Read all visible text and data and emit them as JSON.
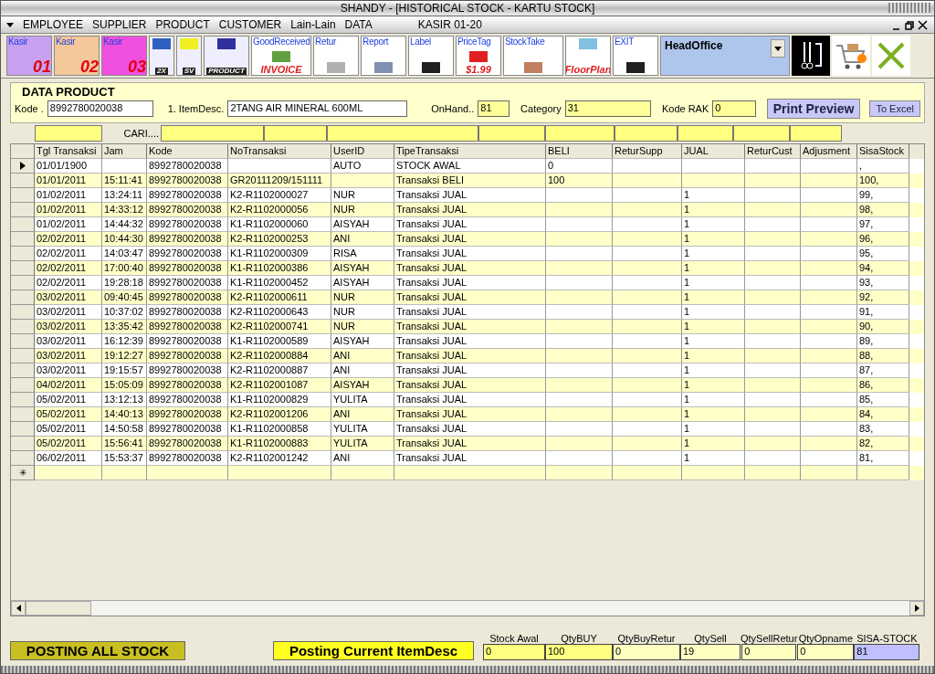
{
  "window": {
    "title": "SHANDY - [HISTORICAL STOCK - KARTU STOCK]"
  },
  "menu": [
    "EMPLOYEE",
    "SUPPLIER",
    "PRODUCT",
    "CUSTOMER",
    "Lain-Lain",
    "DATA"
  ],
  "menu_right": "KASIR 01-20",
  "toolbar": [
    {
      "kind": "kasir",
      "label": "Kasir",
      "sub": "01",
      "color": "#c8a0f0"
    },
    {
      "kind": "kasir",
      "label": "Kasir",
      "sub": "02",
      "color": "#f4c89a"
    },
    {
      "kind": "kasir",
      "label": "Kasir",
      "sub": "03",
      "color": "#f050e0"
    },
    {
      "kind": "art",
      "sub": "2X",
      "color": "#3060c0"
    },
    {
      "kind": "art",
      "sub": "SV",
      "color": "#f0f020"
    },
    {
      "kind": "art",
      "sub": "PRODUCT",
      "color": "#3030a0"
    },
    {
      "kind": "labeled",
      "label": "GoodReceived",
      "sub": "INVOICE",
      "color": "#60a040"
    },
    {
      "kind": "labeled",
      "label": "Retur",
      "color": "#b0b0b0"
    },
    {
      "kind": "labeled",
      "label": "Report",
      "color": "#8090b0"
    },
    {
      "kind": "labeled",
      "label": "Label",
      "color": "#202020"
    },
    {
      "kind": "labeled",
      "label": "PriceTag",
      "sub": "$1.99",
      "color": "#e02020"
    },
    {
      "kind": "labeled",
      "label": "StockTake",
      "color": "#c08060"
    },
    {
      "kind": "labeled",
      "sub": "FloorPlan",
      "color": "#80c0e0"
    },
    {
      "kind": "labeled",
      "label": "EXIT",
      "color": "#202020"
    }
  ],
  "branch": {
    "value": "HeadOffice"
  },
  "section": "DATA PRODUCT",
  "fields": [
    {
      "label": "Kode .",
      "value": "8992780020038",
      "kind": "white"
    },
    {
      "label": "1. ItemDesc.",
      "value": "2TANG AIR MINERAL 600ML",
      "kind": "white"
    },
    {
      "label": "OnHand..",
      "value": "81",
      "kind": "yellow"
    },
    {
      "label": "Category",
      "value": "31",
      "kind": "yellow"
    },
    {
      "label": "Kode RAK",
      "value": "0",
      "kind": "yellow"
    }
  ],
  "buttons": {
    "print": "Print Preview",
    "excel": "To Excel"
  },
  "search_label": "CARI....",
  "table": {
    "columns": [
      "Tgl Transaksi",
      "Jam",
      "Kode",
      "NoTransaksi",
      "UserID",
      "TipeTransaksi",
      "BELI",
      "ReturSupp",
      "JUAL",
      "ReturCust",
      "Adjusment",
      "SisaStock"
    ],
    "rows": [
      {
        "selected": true,
        "cells": [
          "01/01/1900",
          "",
          "8992780020038",
          "",
          "AUTO",
          "STOCK AWAL",
          "0",
          "",
          "",
          "",
          "",
          ","
        ]
      },
      {
        "selected": false,
        "cells": [
          "01/01/2011",
          "15:11:41",
          "8992780020038",
          "GR20111209/151111",
          "",
          "Transaksi BELI",
          "100",
          "",
          "",
          "",
          "",
          "100,"
        ]
      },
      {
        "selected": false,
        "cells": [
          "01/02/2011",
          "13:24:11",
          "8992780020038",
          "K2-R1102000027",
          "NUR",
          "Transaksi JUAL",
          "",
          "",
          "1",
          "",
          "",
          "99,"
        ]
      },
      {
        "selected": false,
        "cells": [
          "01/02/2011",
          "14:33:12",
          "8992780020038",
          "K2-R1102000056",
          "NUR",
          "Transaksi JUAL",
          "",
          "",
          "1",
          "",
          "",
          "98,"
        ]
      },
      {
        "selected": false,
        "cells": [
          "01/02/2011",
          "14:44:32",
          "8992780020038",
          "K1-R1102000060",
          "AISYAH",
          "Transaksi JUAL",
          "",
          "",
          "1",
          "",
          "",
          "97,"
        ]
      },
      {
        "selected": false,
        "cells": [
          "02/02/2011",
          "10:44:30",
          "8992780020038",
          "K2-R1102000253",
          "ANI",
          "Transaksi JUAL",
          "",
          "",
          "1",
          "",
          "",
          "96,"
        ]
      },
      {
        "selected": false,
        "cells": [
          "02/02/2011",
          "14:03:47",
          "8992780020038",
          "K1-R1102000309",
          "RISA",
          "Transaksi JUAL",
          "",
          "",
          "1",
          "",
          "",
          "95,"
        ]
      },
      {
        "selected": false,
        "cells": [
          "02/02/2011",
          "17:00:40",
          "8992780020038",
          "K1-R1102000386",
          "AISYAH",
          "Transaksi JUAL",
          "",
          "",
          "1",
          "",
          "",
          "94,"
        ]
      },
      {
        "selected": false,
        "cells": [
          "02/02/2011",
          "19:28:18",
          "8992780020038",
          "K1-R1102000452",
          "AISYAH",
          "Transaksi JUAL",
          "",
          "",
          "1",
          "",
          "",
          "93,"
        ]
      },
      {
        "selected": false,
        "cells": [
          "03/02/2011",
          "09:40:45",
          "8992780020038",
          "K2-R1102000611",
          "NUR",
          "Transaksi JUAL",
          "",
          "",
          "1",
          "",
          "",
          "92,"
        ]
      },
      {
        "selected": false,
        "cells": [
          "03/02/2011",
          "10:37:02",
          "8992780020038",
          "K2-R1102000643",
          "NUR",
          "Transaksi JUAL",
          "",
          "",
          "1",
          "",
          "",
          "91,"
        ]
      },
      {
        "selected": false,
        "cells": [
          "03/02/2011",
          "13:35:42",
          "8992780020038",
          "K2-R1102000741",
          "NUR",
          "Transaksi JUAL",
          "",
          "",
          "1",
          "",
          "",
          "90,"
        ]
      },
      {
        "selected": false,
        "cells": [
          "03/02/2011",
          "16:12:39",
          "8992780020038",
          "K1-R1102000589",
          "AISYAH",
          "Transaksi JUAL",
          "",
          "",
          "1",
          "",
          "",
          "89,"
        ]
      },
      {
        "selected": false,
        "cells": [
          "03/02/2011",
          "19:12:27",
          "8992780020038",
          "K2-R1102000884",
          "ANI",
          "Transaksi JUAL",
          "",
          "",
          "1",
          "",
          "",
          "88,"
        ]
      },
      {
        "selected": false,
        "cells": [
          "03/02/2011",
          "19:15:57",
          "8992780020038",
          "K2-R1102000887",
          "ANI",
          "Transaksi JUAL",
          "",
          "",
          "1",
          "",
          "",
          "87,"
        ]
      },
      {
        "selected": false,
        "cells": [
          "04/02/2011",
          "15:05:09",
          "8992780020038",
          "K2-R1102001087",
          "AISYAH",
          "Transaksi JUAL",
          "",
          "",
          "1",
          "",
          "",
          "86,"
        ]
      },
      {
        "selected": false,
        "cells": [
          "05/02/2011",
          "13:12:13",
          "8992780020038",
          "K1-R1102000829",
          "YULITA",
          "Transaksi JUAL",
          "",
          "",
          "1",
          "",
          "",
          "85,"
        ]
      },
      {
        "selected": false,
        "cells": [
          "05/02/2011",
          "14:40:13",
          "8992780020038",
          "K2-R1102001206",
          "ANI",
          "Transaksi JUAL",
          "",
          "",
          "1",
          "",
          "",
          "84,"
        ]
      },
      {
        "selected": false,
        "cells": [
          "05/02/2011",
          "14:50:58",
          "8992780020038",
          "K1-R1102000858",
          "YULITA",
          "Transaksi JUAL",
          "",
          "",
          "1",
          "",
          "",
          "83,"
        ]
      },
      {
        "selected": false,
        "cells": [
          "05/02/2011",
          "15:56:41",
          "8992780020038",
          "K1-R1102000883",
          "YULITA",
          "Transaksi JUAL",
          "",
          "",
          "1",
          "",
          "",
          "82,"
        ]
      },
      {
        "selected": false,
        "cells": [
          "06/02/2011",
          "15:53:37",
          "8992780020038",
          "K2-R1102001242",
          "ANI",
          "Transaksi JUAL",
          "",
          "",
          "1",
          "",
          "",
          "81,"
        ]
      }
    ],
    "new_row_mark": "✳"
  },
  "posting_all": "POSTING ALL STOCK",
  "posting_current": "Posting Current ItemDesc",
  "totals": [
    {
      "label": "Stock Awal",
      "value": "0",
      "color": "#ffff80"
    },
    {
      "label": "QtyBUY",
      "value": "100",
      "color": "#ffff80"
    },
    {
      "label": "QtyBuyRetur",
      "value": "0",
      "color": "#ffffc0"
    },
    {
      "label": "QtySell",
      "value": "19",
      "color": "#ffffc0"
    },
    {
      "label": "QtySellRetur",
      "value": "0",
      "color": "#ffffc0"
    },
    {
      "label": "QtyOpname",
      "value": "0",
      "color": "#ffffc0"
    },
    {
      "label": "SISA-STOCK",
      "value": "81",
      "color": "#c0c0ff"
    }
  ]
}
